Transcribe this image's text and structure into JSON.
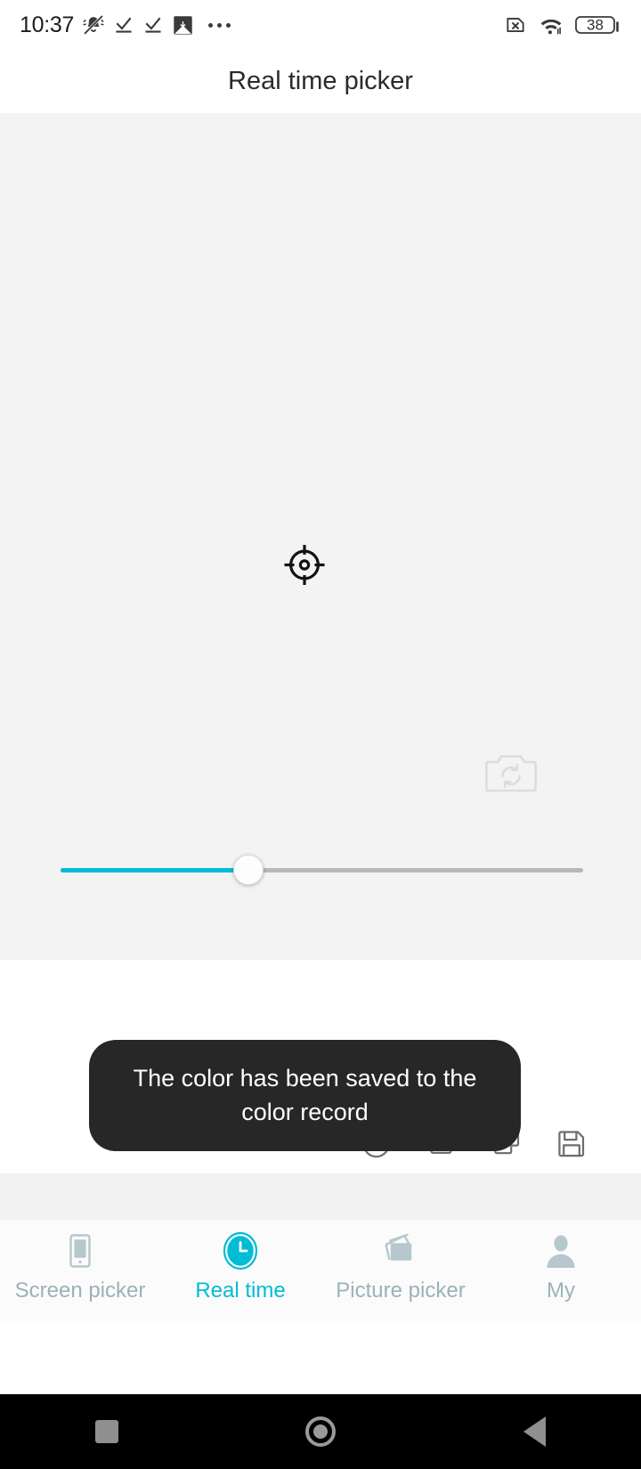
{
  "status_bar": {
    "time": "10:37",
    "left_icons": [
      "bell-mute-icon",
      "task-done-icon",
      "task-done-icon",
      "image-download-icon",
      "overflow-dots-icon"
    ],
    "right_icons": [
      "sim-card-disabled-icon",
      "wifi-icon",
      "battery-icon"
    ],
    "battery_level": "38"
  },
  "header": {
    "title": "Real time picker"
  },
  "preview": {
    "crosshair_icon": "crosshair-target-icon",
    "camera_flip_icon": "camera-switch-icon",
    "background_color": "#f3f3f3"
  },
  "zoom_slider": {
    "value": 36,
    "min": 0,
    "max": 100,
    "fill_color": "#00bcd4",
    "track_color": "#b8b8b8"
  },
  "toast": {
    "message": "The color has been saved to the color record",
    "background_color": "#272727"
  },
  "action_row": {
    "buttons": [
      {
        "name": "font-rotate-button",
        "icon": "rotate-f-icon"
      },
      {
        "name": "export-image-button",
        "icon": "image-export-icon"
      },
      {
        "name": "copy-text-button",
        "icon": "copy-text-icon"
      },
      {
        "name": "save-button",
        "icon": "floppy-save-icon"
      }
    ]
  },
  "bottom_nav": {
    "active_color": "#00bcd4",
    "inactive_color": "#9bb2bb",
    "items": [
      {
        "label": "Screen picker",
        "icon": "phone-screen-icon",
        "active": false
      },
      {
        "label": "Real time",
        "icon": "clock-icon",
        "active": true
      },
      {
        "label": "Picture picker",
        "icon": "pictures-icon",
        "active": false
      },
      {
        "label": "My",
        "icon": "person-icon",
        "active": false
      }
    ]
  },
  "system_nav": {
    "buttons": [
      "recents-square-button",
      "home-circle-button",
      "back-triangle-button"
    ]
  }
}
